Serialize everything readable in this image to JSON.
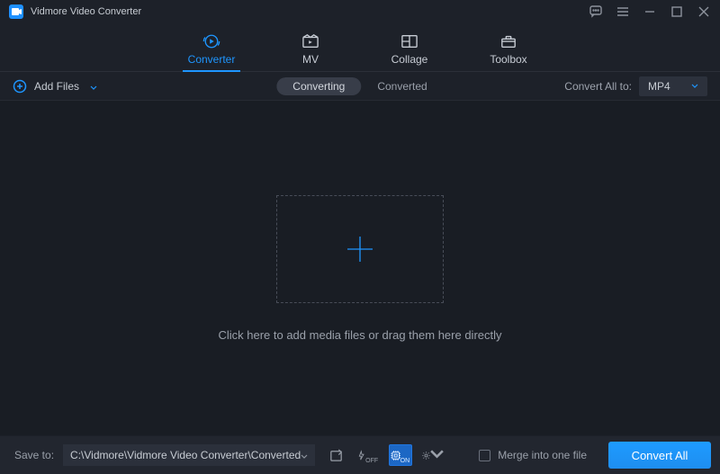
{
  "app": {
    "title": "Vidmore Video Converter"
  },
  "nav": {
    "converter": "Converter",
    "mv": "MV",
    "collage": "Collage",
    "toolbox": "Toolbox"
  },
  "toolbar": {
    "add_files": "Add Files",
    "converting": "Converting",
    "converted": "Converted",
    "convert_all_to_label": "Convert All to:",
    "selected_format": "MP4"
  },
  "main": {
    "drop_text": "Click here to add media files or drag them here directly"
  },
  "bottom": {
    "save_to_label": "Save to:",
    "save_path": "C:\\Vidmore\\Vidmore Video Converter\\Converted",
    "gpu_switch": "ON",
    "speed_switch": "OFF",
    "merge_label": "Merge into one file",
    "convert_all_btn": "Convert All"
  }
}
